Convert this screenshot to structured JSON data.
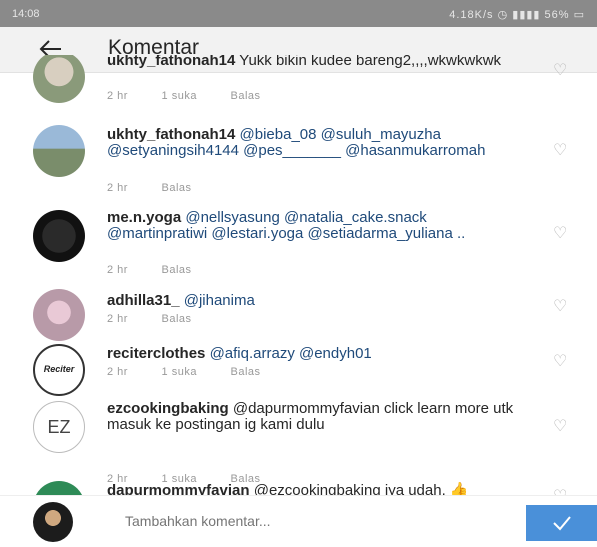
{
  "statusbar": {
    "time": "14:08",
    "right": "4.18K/s  ◷  ▮▮▮▮  56% ▭"
  },
  "header": {
    "back_icon": "arrow-left-icon",
    "title": "Komentar"
  },
  "comments": [
    {
      "username": "ukhty_fathonah14",
      "text": "Yukk bikin kudee bareng2,,,,wkwkwkwk",
      "meta": [
        "2 hr",
        "1 suka",
        "Balas"
      ]
    },
    {
      "username": "ukhty_fathonah14",
      "text": "@bieba_08 @suluh_mayuzha @setyaningsih4144 @pes_______ @hasanmukarromah",
      "meta": [
        "2 hr",
        "Balas"
      ]
    },
    {
      "username": "me.n.yoga",
      "text": "@nellsyasung @natalia_cake.snack @martinpratiwi @lestari.yoga @setiadarma_yuliana ..",
      "meta": [
        "2 hr",
        "Balas"
      ]
    },
    {
      "username": "adhilla31_",
      "text": "@jihanima",
      "meta": [
        "2 hr",
        "Balas"
      ]
    },
    {
      "username": "reciterclothes",
      "text": "@afiq.arrazy @endyh01",
      "meta": [
        "2 hr",
        "1 suka",
        "Balas"
      ]
    },
    {
      "username": "ezcookingbaking",
      "text": "@dapurmommyfavian click learn more utk masuk ke postingan ig kami dulu",
      "meta": [
        "2 hr",
        "1 suka",
        "Balas"
      ]
    },
    {
      "username": "dapurmommyfavian",
      "text": "@ezcookingbaking iya udah. 👍",
      "meta": []
    }
  ],
  "composer": {
    "placeholder": "Tambahkan komentar...",
    "send_icon": "check-icon"
  },
  "colors": {
    "mention": "#1f4a7a",
    "send": "#4a90d9",
    "statusbar": "#8a8a8a"
  }
}
